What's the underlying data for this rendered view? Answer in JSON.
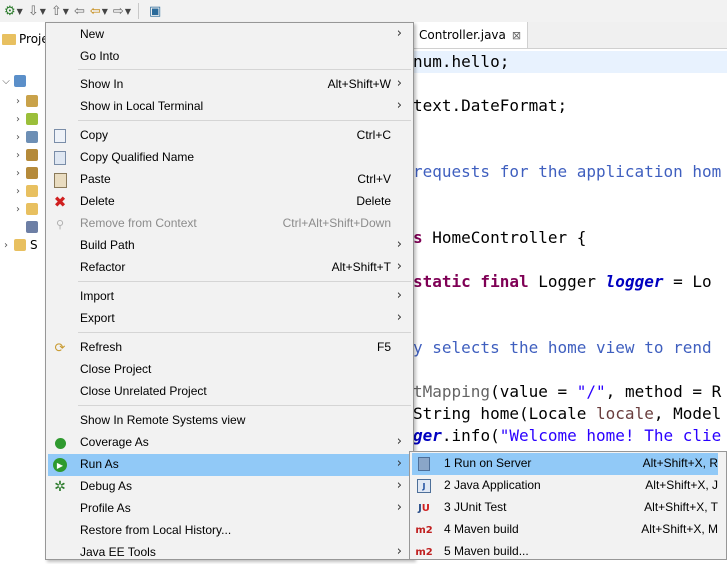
{
  "explorer": {
    "tab_label": "Proje",
    "other_label": "S"
  },
  "editor": {
    "tab_title": "Controller.java",
    "lines": [
      {
        "parts": [
          {
            "t": "num.hello;",
            "c": ""
          }
        ],
        "hl": true
      },
      {
        "parts": [
          {
            "t": "text.DateFormat;",
            "c": ""
          }
        ],
        "hl": false
      },
      {
        "parts": [
          {
            "t": "requests for the application hom",
            "c": "cm"
          }
        ],
        "hl": false
      },
      {
        "parts": [
          {
            "t": "s ",
            "c": "kw"
          },
          {
            "t": "HomeController {",
            "c": ""
          }
        ],
        "hl": false
      },
      {
        "parts": [
          {
            "t": "static final ",
            "c": "kw"
          },
          {
            "t": "Logger ",
            "c": ""
          },
          {
            "t": "logger",
            "c": "fld"
          },
          {
            "t": " = Lo",
            "c": ""
          }
        ],
        "hl": false
      },
      {
        "parts": [
          {
            "t": "y selects the home view to rend",
            "c": "cm"
          }
        ],
        "hl": false
      },
      {
        "parts": [
          {
            "t": "tMapping",
            "c": "an"
          },
          {
            "t": "(value = ",
            "c": ""
          },
          {
            "t": "\"/\"",
            "c": "st"
          },
          {
            "t": ", method = R",
            "c": ""
          }
        ],
        "hl": false
      },
      {
        "parts": [
          {
            "t": "String home(Locale ",
            "c": ""
          },
          {
            "t": "locale",
            "c": "var"
          },
          {
            "t": ", Model",
            "c": ""
          }
        ],
        "hl": false
      },
      {
        "parts": [
          {
            "t": "ger",
            "c": "fld"
          },
          {
            "t": ".info(",
            "c": ""
          },
          {
            "t": "\"Welcome home! The clie",
            "c": "st"
          }
        ],
        "hl": false
      }
    ]
  },
  "context_menu": {
    "items": [
      {
        "label": "New",
        "shortcut": "",
        "submenu": true,
        "icon": "none"
      },
      {
        "label": "Go Into",
        "shortcut": "",
        "submenu": false,
        "icon": "none"
      },
      {
        "label": "Show In",
        "shortcut": "Alt+Shift+W",
        "submenu": true,
        "icon": "none"
      },
      {
        "label": "Show in Local Terminal",
        "shortcut": "",
        "submenu": true,
        "icon": "none"
      },
      {
        "label": "Copy",
        "shortcut": "Ctrl+C",
        "submenu": false,
        "icon": "copy-icon"
      },
      {
        "label": "Copy Qualified Name",
        "shortcut": "",
        "submenu": false,
        "icon": "copy-qualified-icon"
      },
      {
        "label": "Paste",
        "shortcut": "Ctrl+V",
        "submenu": false,
        "icon": "paste-icon"
      },
      {
        "label": "Delete",
        "shortcut": "Delete",
        "submenu": false,
        "icon": "delete-icon"
      },
      {
        "label": "Remove from Context",
        "shortcut": "Ctrl+Alt+Shift+Down",
        "submenu": false,
        "icon": "remove-context-icon",
        "disabled": true
      },
      {
        "label": "Build Path",
        "shortcut": "",
        "submenu": true,
        "icon": "none"
      },
      {
        "label": "Refactor",
        "shortcut": "Alt+Shift+T",
        "submenu": true,
        "icon": "none"
      },
      {
        "label": "Import",
        "shortcut": "",
        "submenu": true,
        "icon": "none"
      },
      {
        "label": "Export",
        "shortcut": "",
        "submenu": true,
        "icon": "none"
      },
      {
        "label": "Refresh",
        "shortcut": "F5",
        "submenu": false,
        "icon": "refresh-icon"
      },
      {
        "label": "Close Project",
        "shortcut": "",
        "submenu": false,
        "icon": "none"
      },
      {
        "label": "Close Unrelated Project",
        "shortcut": "",
        "submenu": false,
        "icon": "none"
      },
      {
        "label": "Show In Remote Systems view",
        "shortcut": "",
        "submenu": false,
        "icon": "none"
      },
      {
        "label": "Coverage As",
        "shortcut": "",
        "submenu": true,
        "icon": "coverage-icon"
      },
      {
        "label": "Run As",
        "shortcut": "",
        "submenu": true,
        "icon": "run-icon",
        "selected": true
      },
      {
        "label": "Debug As",
        "shortcut": "",
        "submenu": true,
        "icon": "debug-icon"
      },
      {
        "label": "Profile As",
        "shortcut": "",
        "submenu": true,
        "icon": "none"
      },
      {
        "label": "Restore from Local History...",
        "shortcut": "",
        "submenu": false,
        "icon": "none"
      },
      {
        "label": "Java EE Tools",
        "shortcut": "",
        "submenu": true,
        "icon": "none"
      }
    ]
  },
  "run_as_submenu": {
    "items": [
      {
        "label": "1 Run on Server",
        "shortcut": "Alt+Shift+X, R",
        "icon": "server-icon",
        "selected": true
      },
      {
        "label": "2 Java Application",
        "shortcut": "Alt+Shift+X, J",
        "icon": "java-app-icon"
      },
      {
        "label": "3 JUnit Test",
        "shortcut": "Alt+Shift+X, T",
        "icon": "junit-icon"
      },
      {
        "label": "4 Maven build",
        "shortcut": "Alt+Shift+X, M",
        "icon": "maven-icon"
      },
      {
        "label": "5 Maven build...",
        "shortcut": "",
        "icon": "maven-icon"
      }
    ]
  },
  "colors": {
    "selection": "#91c9f7",
    "menu_bg": "#f2f2f2",
    "editor_highlight": "#e8f2fe"
  }
}
